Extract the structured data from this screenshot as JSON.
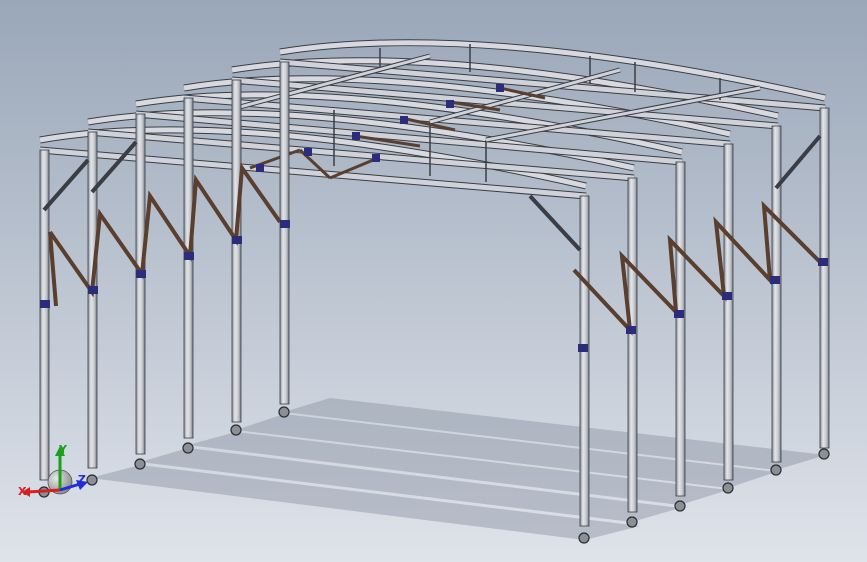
{
  "viewport": {
    "background_top": "#9aa7b8",
    "background_bottom": "#dfe3ea"
  },
  "model": {
    "description_colors": {
      "tube": "#c9ccd3",
      "tube_edge": "#3a3d44",
      "brace": "#5a3e2e",
      "clamp": "#2c2d7a",
      "wheel": "#8b8f96",
      "shadow": "#8a93a3"
    }
  },
  "triad": {
    "x_label": "X",
    "y_label": "Y",
    "z_label": "Z",
    "x_color": "#d81e1e",
    "y_color": "#1aa01a",
    "z_color": "#1e2ed8"
  }
}
